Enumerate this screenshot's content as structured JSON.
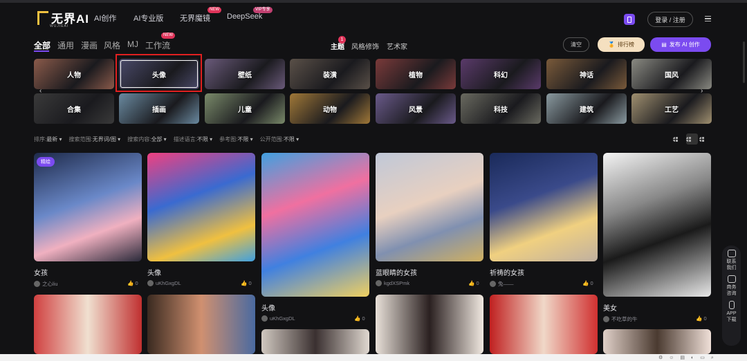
{
  "brand": {
    "name": "无界AI",
    "sub": "WUJIEAI"
  },
  "nav": [
    {
      "label": "AI创作"
    },
    {
      "label": "AI专业版"
    },
    {
      "label": "无界魔镜",
      "badge": "NEW"
    },
    {
      "label": "DeepSeek",
      "badge": "VIP专享"
    }
  ],
  "header": {
    "login": "登录 / 注册"
  },
  "categories": [
    {
      "label": "全部",
      "active": true
    },
    {
      "label": "通用"
    },
    {
      "label": "漫画"
    },
    {
      "label": "风格"
    },
    {
      "label": "MJ"
    },
    {
      "label": "工作流",
      "badge": "NEW"
    }
  ],
  "tabs": [
    {
      "label": "主题",
      "active": true,
      "count": "1"
    },
    {
      "label": "风格修饰"
    },
    {
      "label": "艺术家"
    }
  ],
  "actions": {
    "clear": "清空",
    "rank": "排行榜",
    "publish": "发布 AI 创作"
  },
  "tiles": [
    {
      "label": "人物",
      "color": "#8a5a4a"
    },
    {
      "label": "头像",
      "color": "#4a4a6a",
      "selected": true
    },
    {
      "label": "壁纸",
      "color": "#6a5a7a"
    },
    {
      "label": "装潢",
      "color": "#5a5048"
    },
    {
      "label": "植物",
      "color": "#7a3a3a"
    },
    {
      "label": "科幻",
      "color": "#5a3a6a"
    },
    {
      "label": "神话",
      "color": "#7a5a3a"
    },
    {
      "label": "国风",
      "color": "#8a8a82"
    },
    {
      "label": "合集",
      "color": "#3a3a3a"
    },
    {
      "label": "插画",
      "color": "#6a8aa0"
    },
    {
      "label": "儿童",
      "color": "#7a8a6a"
    },
    {
      "label": "动物",
      "color": "#a07838"
    },
    {
      "label": "风景",
      "color": "#6a5a8a"
    },
    {
      "label": "科技",
      "color": "#6a6a60"
    },
    {
      "label": "建筑",
      "color": "#8a9aa0"
    },
    {
      "label": "工艺",
      "color": "#a09070"
    }
  ],
  "filters": [
    {
      "key": "排序:",
      "value": "最新"
    },
    {
      "key": "搜索范围:",
      "value": "无界词/图"
    },
    {
      "key": "搜索内容:",
      "value": "全部"
    },
    {
      "key": "描述语言:",
      "value": "不限"
    },
    {
      "key": "参考图:",
      "value": "不限"
    },
    {
      "key": "公开范围:",
      "value": "不限"
    }
  ],
  "cards": [
    {
      "title": "女孩",
      "author": "之心liu",
      "likes": "0",
      "tag": "精绘"
    },
    {
      "title": "头像",
      "author": "uKhGxgDL",
      "likes": "0"
    },
    {
      "title": "头像",
      "author": "uKhGxgDL",
      "likes": "0"
    },
    {
      "title": "蓝眼睛的女孩",
      "author": "kgdXSPmk",
      "likes": "0"
    },
    {
      "title": "祈祷的女孩",
      "author": "兔——",
      "likes": "0"
    },
    {
      "title": "美女",
      "author": "不吃草的牛",
      "likes": "0"
    }
  ],
  "side": [
    {
      "label": "联系我们"
    },
    {
      "label": "商务咨询"
    },
    {
      "label": "APP下载"
    }
  ],
  "colors": {
    "accent": "#7b4bf0",
    "bg": "#121214",
    "highlight": "#e02020"
  }
}
